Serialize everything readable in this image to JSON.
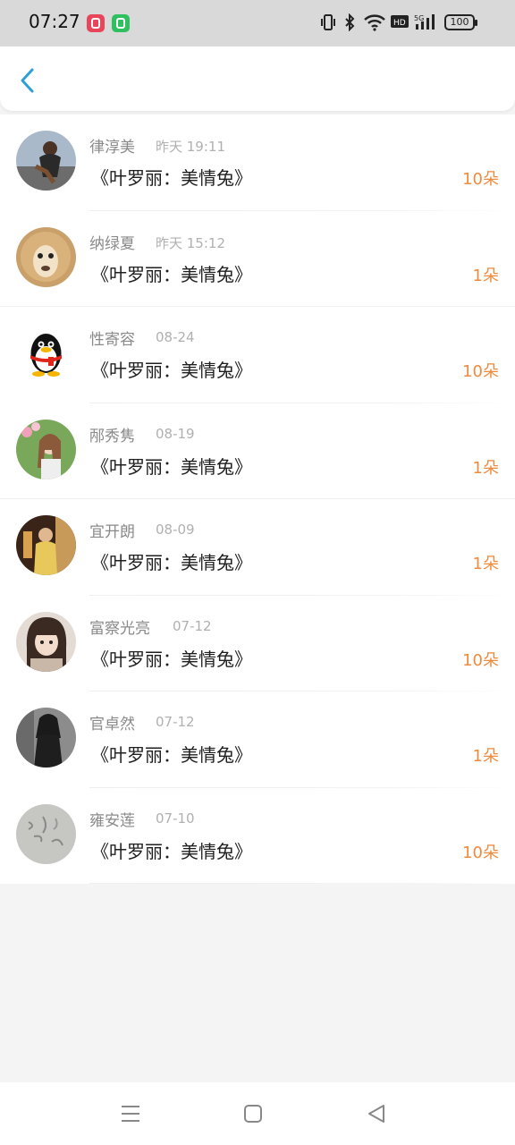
{
  "status_bar": {
    "time": "07:27",
    "battery": "100",
    "icons": [
      "vibrate-icon",
      "bluetooth-icon",
      "wifi-icon",
      "hd-icon",
      "signal-5g-icon",
      "battery-icon"
    ]
  },
  "header": {
    "back_icon": "chevron-left-icon",
    "accent": "#2e9fd6"
  },
  "records": [
    {
      "name": "律淳美",
      "time": "昨天 19:11",
      "gift": "《叶罗丽：美情兔》",
      "count": "10朵"
    },
    {
      "name": "纳绿夏",
      "time": "昨天 15:12",
      "gift": "《叶罗丽：美情兔》",
      "count": "1朵"
    },
    {
      "name": "性寄容",
      "time": "08-24",
      "gift": "《叶罗丽：美情兔》",
      "count": "10朵"
    },
    {
      "name": "邴秀隽",
      "time": "08-19",
      "gift": "《叶罗丽：美情兔》",
      "count": "1朵"
    },
    {
      "name": "宜开朗",
      "time": "08-09",
      "gift": "《叶罗丽：美情兔》",
      "count": "1朵"
    },
    {
      "name": "富察光亮",
      "time": "07-12",
      "gift": "《叶罗丽：美情兔》",
      "count": "10朵"
    },
    {
      "name": "官卓然",
      "time": "07-12",
      "gift": "《叶罗丽：美情兔》",
      "count": "1朵"
    },
    {
      "name": "雍安莲",
      "time": "07-10",
      "gift": "《叶罗丽：美情兔》",
      "count": "10朵"
    }
  ],
  "colors": {
    "count": "#f08a3c",
    "name": "#8a8a8a",
    "time": "#b0b0b0"
  },
  "bottom_nav": [
    "menu-icon",
    "home-icon",
    "back-triangle-icon"
  ]
}
